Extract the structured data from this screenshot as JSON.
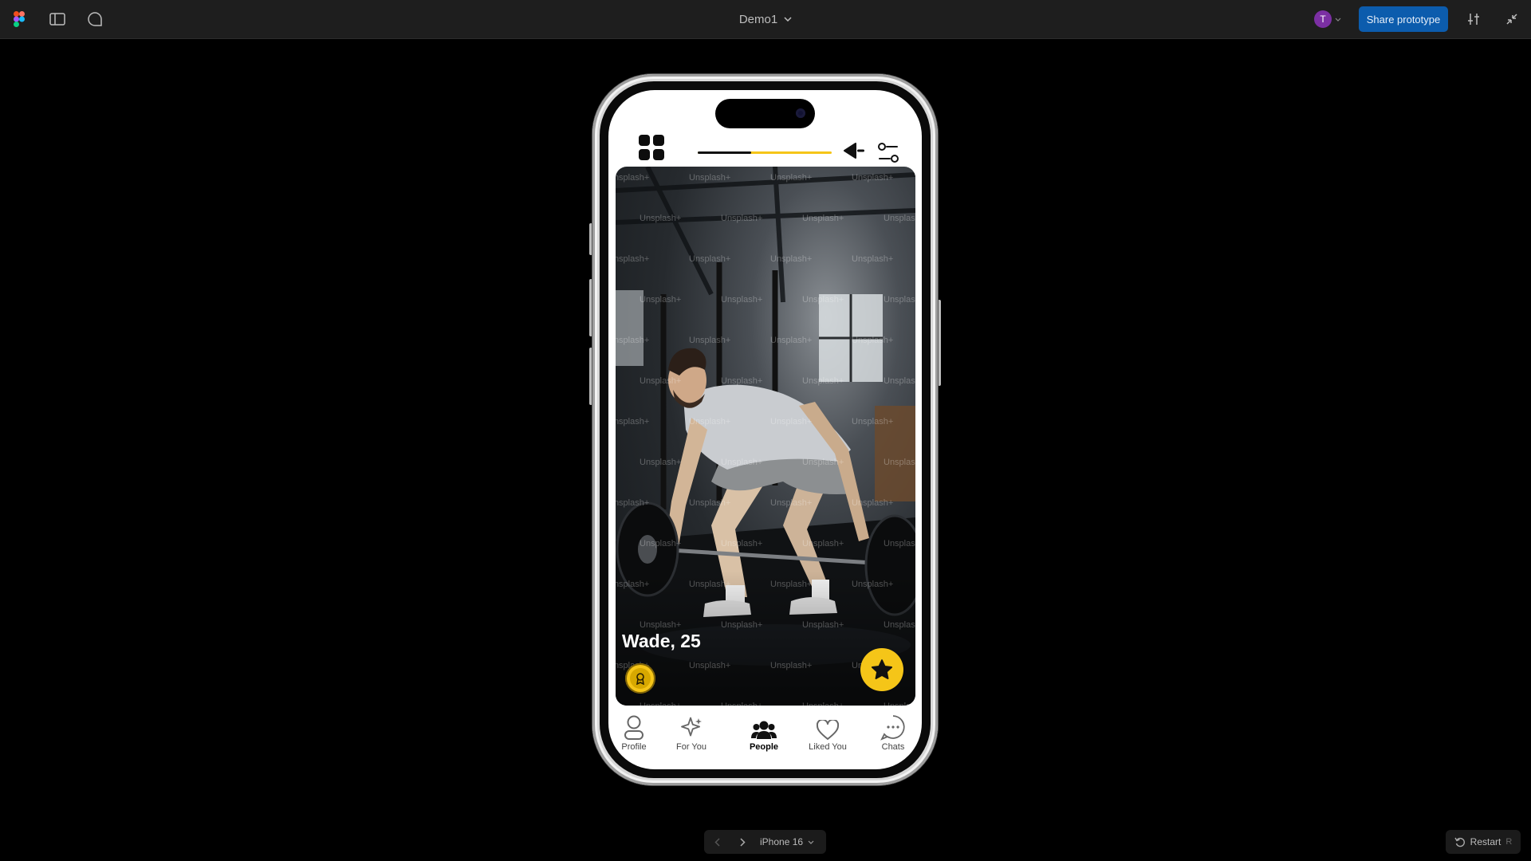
{
  "toolbar": {
    "file_name": "Demo1",
    "user_initial": "T",
    "share_label": "Share prototype",
    "icons": [
      "figma-logo-icon",
      "sidebar-toggle-icon",
      "comment-icon",
      "chevron-down-icon",
      "settings-sliders-icon",
      "collapse-icon"
    ]
  },
  "colors": {
    "accent": "#f5c518",
    "share_button": "#0c5cad",
    "avatar": "#7b2fa3",
    "background": "#000000"
  },
  "app": {
    "progress_fraction": 0.4,
    "profile": {
      "name_age": "Wade, 25",
      "watermark": "Unsplash+"
    },
    "tabs": [
      {
        "label": "Profile",
        "icon": "person-icon",
        "active": false
      },
      {
        "label": "For You",
        "icon": "sparkle-icon",
        "active": false
      },
      {
        "label": "People",
        "icon": "people-icon",
        "active": true
      },
      {
        "label": "Liked You",
        "icon": "heart-icon",
        "active": false
      },
      {
        "label": "Chats",
        "icon": "chat-icon",
        "active": false
      }
    ]
  },
  "footer": {
    "device_label": "iPhone 16",
    "restart_label": "Restart",
    "restart_key": "R"
  }
}
